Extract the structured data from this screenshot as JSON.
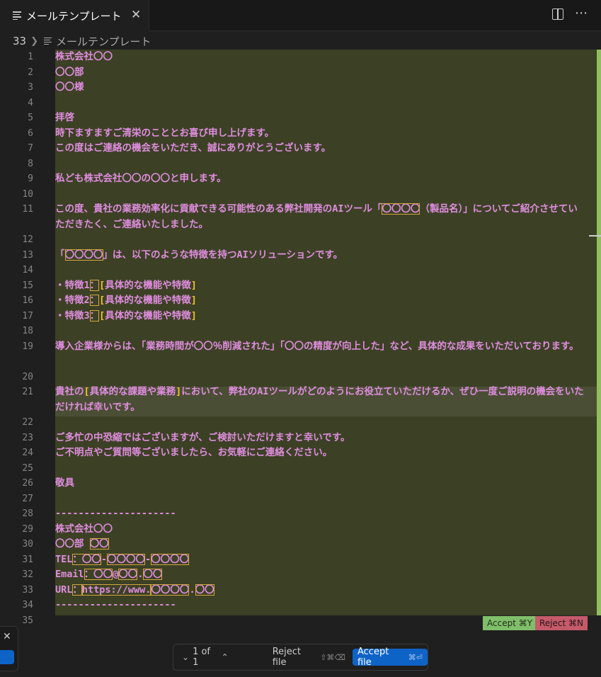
{
  "tab": {
    "title": "メールテンプレート",
    "close": "✕"
  },
  "tab_actions": {
    "more": "⋯"
  },
  "breadcrumb": {
    "line_number": "33",
    "file": "メールテンプレート"
  },
  "editor": {
    "lines": [
      {
        "n": "1",
        "segs": [
          {
            "t": "株式会社"
          },
          {
            "t": "〇〇"
          }
        ]
      },
      {
        "n": "2",
        "segs": [
          {
            "t": "〇〇部"
          }
        ]
      },
      {
        "n": "3",
        "segs": [
          {
            "t": "〇〇様"
          }
        ]
      },
      {
        "n": "4",
        "segs": []
      },
      {
        "n": "5",
        "segs": [
          {
            "t": "拝啓"
          }
        ]
      },
      {
        "n": "6",
        "segs": [
          {
            "t": "時下ますますご清栄のこととお喜び申し上げます。"
          }
        ]
      },
      {
        "n": "7",
        "segs": [
          {
            "t": "この度はご連絡の機会をいただき、誠にありがとうございます。"
          }
        ]
      },
      {
        "n": "8",
        "segs": []
      },
      {
        "n": "9",
        "segs": [
          {
            "t": "私ども株式会社〇〇の〇〇と申します。"
          }
        ]
      },
      {
        "n": "10",
        "segs": []
      },
      {
        "n": "11",
        "segs": [
          {
            "t": "この度、貴社の業務効率化に貢献できる可能性のある弊社開発のAIツール「"
          },
          {
            "t": "〇〇〇〇",
            "h": 1
          },
          {
            "t": "（製品名）」についてご紹介させていただきたく、ご連絡いたしました。"
          }
        ],
        "wrap": true
      },
      {
        "n": "12",
        "segs": []
      },
      {
        "n": "13",
        "segs": [
          {
            "t": "「"
          },
          {
            "t": "〇〇〇〇",
            "h": 1
          },
          {
            "t": "」は、以下のような特徴を持つAIソリューションです。"
          }
        ]
      },
      {
        "n": "14",
        "segs": []
      },
      {
        "n": "15",
        "segs": [
          {
            "t": "・特徴1"
          },
          {
            "t": "：",
            "h": 1
          },
          {
            "t": "[",
            "y": 1
          },
          {
            "t": "具体的な機能や特徴"
          },
          {
            "t": "]",
            "y": 1
          }
        ]
      },
      {
        "n": "16",
        "segs": [
          {
            "t": "・特徴2"
          },
          {
            "t": "：",
            "h": 1
          },
          {
            "t": "[",
            "y": 1
          },
          {
            "t": "具体的な機能や特徴"
          },
          {
            "t": "]",
            "y": 1
          }
        ]
      },
      {
        "n": "17",
        "segs": [
          {
            "t": "・特徴3"
          },
          {
            "t": "：",
            "h": 1
          },
          {
            "t": "[",
            "y": 1
          },
          {
            "t": "具体的な機能や特徴"
          },
          {
            "t": "]",
            "y": 1
          }
        ]
      },
      {
        "n": "18",
        "segs": []
      },
      {
        "n": "19",
        "segs": [
          {
            "t": "導入企業様からは、「業務時間が〇〇％削減された」「〇〇の精度が向上した」など、具体的な成果をいただいております。"
          }
        ],
        "wrap": true
      },
      {
        "n": "20",
        "segs": []
      },
      {
        "n": "21",
        "segs": [
          {
            "t": "貴社の"
          },
          {
            "t": "[",
            "y": 1
          },
          {
            "t": "具体的な課題や業務"
          },
          {
            "t": "]",
            "y": 1
          },
          {
            "t": "において、弊社のAIツールがどのようにお役立ていただけるか、ぜひ一度ご説明の機会をいただければ幸いです。"
          }
        ],
        "wrap": true
      },
      {
        "n": "22",
        "segs": []
      },
      {
        "n": "23",
        "segs": [
          {
            "t": "ご多忙の中恐縮ではございますが、ご検討いただけますと幸いです。"
          }
        ]
      },
      {
        "n": "24",
        "segs": [
          {
            "t": "ご不明点やご質問等ございましたら、お気軽にご連絡ください。"
          }
        ]
      },
      {
        "n": "25",
        "segs": []
      },
      {
        "n": "26",
        "segs": [
          {
            "t": "敬具"
          }
        ]
      },
      {
        "n": "27",
        "segs": []
      },
      {
        "n": "28",
        "segs": [
          {
            "t": "---------------------"
          }
        ]
      },
      {
        "n": "29",
        "segs": [
          {
            "t": "株式会社〇〇"
          }
        ]
      },
      {
        "n": "30",
        "segs": [
          {
            "t": "〇〇部 "
          },
          {
            "t": "〇〇",
            "h": 1
          }
        ]
      },
      {
        "n": "31",
        "segs": [
          {
            "t": "TEL"
          },
          {
            "t": "：〇〇",
            "h": 1
          },
          {
            "t": "-"
          },
          {
            "t": "〇〇〇〇",
            "h": 1
          },
          {
            "t": "-"
          },
          {
            "t": "〇〇〇〇",
            "h": 1
          }
        ]
      },
      {
        "n": "32",
        "segs": [
          {
            "t": "Email"
          },
          {
            "t": "：〇〇",
            "h": 1
          },
          {
            "t": "@"
          },
          {
            "t": "〇〇",
            "h": 1
          },
          {
            "t": "."
          },
          {
            "t": "〇〇",
            "h": 1
          }
        ]
      },
      {
        "n": "33",
        "segs": [
          {
            "t": "URL"
          },
          {
            "t": "：",
            "h": 1
          },
          {
            "t": "https://www.",
            "h": 1
          },
          {
            "t": "〇〇〇〇",
            "h": 1
          },
          {
            "t": "."
          },
          {
            "t": "〇〇",
            "h": 1
          }
        ]
      },
      {
        "n": "34",
        "segs": [
          {
            "t": "---------------------"
          }
        ]
      },
      {
        "n": "35",
        "segs": []
      }
    ]
  },
  "inline_chip": {
    "accept": "Accept ⌘Y",
    "reject": "Reject ⌘N"
  },
  "review_bar": {
    "prev": "⌄",
    "count": "1 of 1",
    "next": "⌃",
    "reject_label": "Reject file",
    "reject_shortcut": "⇧⌘⌫",
    "accept_label": "Accept file",
    "accept_shortcut": "⌘⏎"
  },
  "left_fragment": {
    "close": "✕"
  },
  "colors": {
    "accent": "#0e63c7",
    "inserted_bg": "#3c4125",
    "text": "#e08de0",
    "placeholder_outline": "#d5a63e",
    "bracket": "#f2c230",
    "accept_chip": "#80bf6a",
    "reject_chip": "#c45a6a"
  }
}
